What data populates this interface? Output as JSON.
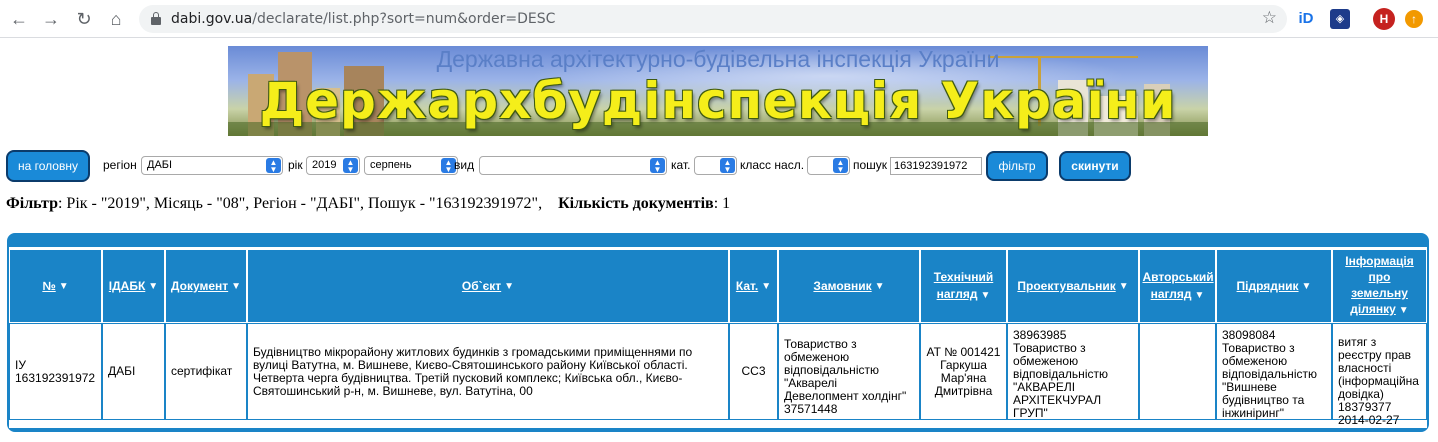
{
  "browser": {
    "url_host": "dabi.gov.ua",
    "url_path": "/declarate/list.php?sort=num&order=DESC",
    "avatar_letter": "H"
  },
  "banner": {
    "subtitle": "Державна архітектурно-будівельна інспекція України",
    "title": "Держархбудінспекція України"
  },
  "filters": {
    "home_label": "на головну",
    "region_label": "регіон",
    "region_value": "ДАБІ",
    "year_label": "рік",
    "year_value": "2019",
    "month_value": "серпень",
    "type_label": "вид",
    "type_value": "",
    "cat_label": "кат.",
    "cat_value": "",
    "class_label": "класс насл.",
    "class_value": "",
    "search_label": "пошук",
    "search_value": "163192391972",
    "filter_label": "фільтр",
    "reset_label": "скинути"
  },
  "summary": {
    "filter_word": "Фільтр",
    "filter_text": ": Рік - \"2019\", Місяць - \"08\", Регіон - \"ДАБІ\", Пошук - \"163192391972\",",
    "count_word": "Кількість документів",
    "count_text": ": 1"
  },
  "table": {
    "headers": [
      "№",
      "ІДАБК",
      "Документ",
      "Об`єкт",
      "Кат.",
      "Замовник",
      "Технічний нагляд",
      "Проектувальник",
      "Авторський нагляд",
      "Підрядник",
      "Інформація про земельну ділянку"
    ],
    "row": {
      "num": "ІУ 163192391972",
      "idabk": "ДАБІ",
      "document": "сертифікат",
      "object": "Будівництво мікрорайону житлових будинків з громадськими приміщеннями по вулиці Ватутна, м. Вишневе, Києво-Святошинського району Київської області. Четверта черга будівництва. Третій пусковий комплекс; Київська обл., Києво-Святошинський р-н, м. Вишневе, вул. Ватутіна, 00",
      "category": "СС3",
      "customer": "Товариство з обмеженою відповідальністю \"Акварелі Девелопмент холдінг\" 37571448",
      "tech_supervision": "АТ № 001421 Гаркуша Мар'яна Дмитрівна",
      "designer": "38963985 Товариство з обмеженою відповідальністю \"АКВАРЕЛІ АРХІТЕКЧУРАЛ ГРУП\"",
      "author_supervision": "",
      "contractor": "38098084 Товариство з обмеженою відповідальністю \"Вишневе будівництво та інжиніринг\"",
      "land_info": "витяг з реєстру прав власності (інформаційна довідка) 18379377 2014-02-27"
    }
  }
}
